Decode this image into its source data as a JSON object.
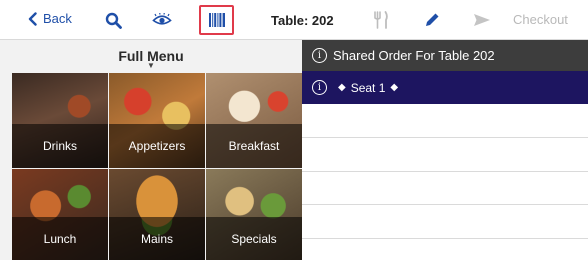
{
  "toolbar": {
    "back_label": "Back",
    "table_label": "Table: 202",
    "checkout_label": "Checkout",
    "icons": {
      "back": "chevron-left-icon",
      "search": "search-icon",
      "eye": "eye-icon",
      "barcode": "barcode-icon",
      "fork_knife": "utensils-icon",
      "pencil": "pencil-icon",
      "send": "send-icon"
    },
    "colors": {
      "accent": "#1f4fa8",
      "highlight_border": "#e03a4a",
      "disabled": "#b9b9b9"
    }
  },
  "menu": {
    "title": "Full Menu",
    "categories": [
      {
        "label": "Drinks"
      },
      {
        "label": "Appetizers"
      },
      {
        "label": "Breakfast"
      },
      {
        "label": "Lunch"
      },
      {
        "label": "Mains"
      },
      {
        "label": "Specials"
      }
    ]
  },
  "order": {
    "shared_label": "Shared Order For Table 202",
    "seat_label": "Seat 1",
    "colors": {
      "shared_bar": "#3d3d3d",
      "seat_bar": "#1d1560"
    }
  }
}
